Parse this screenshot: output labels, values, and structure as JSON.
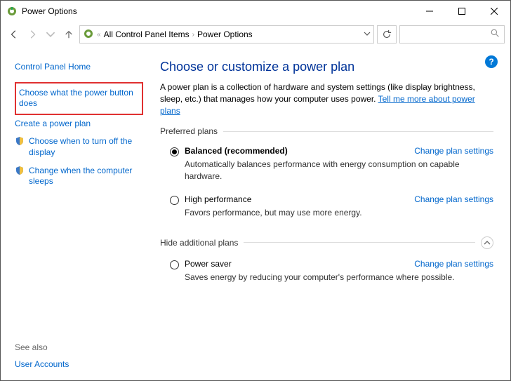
{
  "window": {
    "title": "Power Options"
  },
  "breadcrumb": {
    "cp": "All Control Panel Items",
    "current": "Power Options"
  },
  "sidebar": {
    "home": "Control Panel Home",
    "links": [
      "Choose what the power button does",
      "Create a power plan",
      "Choose when to turn off the display",
      "Change when the computer sleeps"
    ],
    "seealso_label": "See also",
    "seealso": "User Accounts"
  },
  "content": {
    "heading": "Choose or customize a power plan",
    "desc_pre": "A power plan is a collection of hardware and system settings (like display brightness, sleep, etc.) that manages how your computer uses power. ",
    "desc_link": "Tell me more about power plans",
    "preferred_label": "Preferred plans",
    "hide_label": "Hide additional plans",
    "change_label": "Change plan settings",
    "plans": [
      {
        "name": "Balanced (recommended)",
        "desc": "Automatically balances performance with energy consumption on capable hardware.",
        "checked": true
      },
      {
        "name": "High performance",
        "desc": "Favors performance, but may use more energy.",
        "checked": false
      }
    ],
    "hidden_plans": [
      {
        "name": "Power saver",
        "desc": "Saves energy by reducing your computer's performance where possible.",
        "checked": false
      }
    ]
  }
}
